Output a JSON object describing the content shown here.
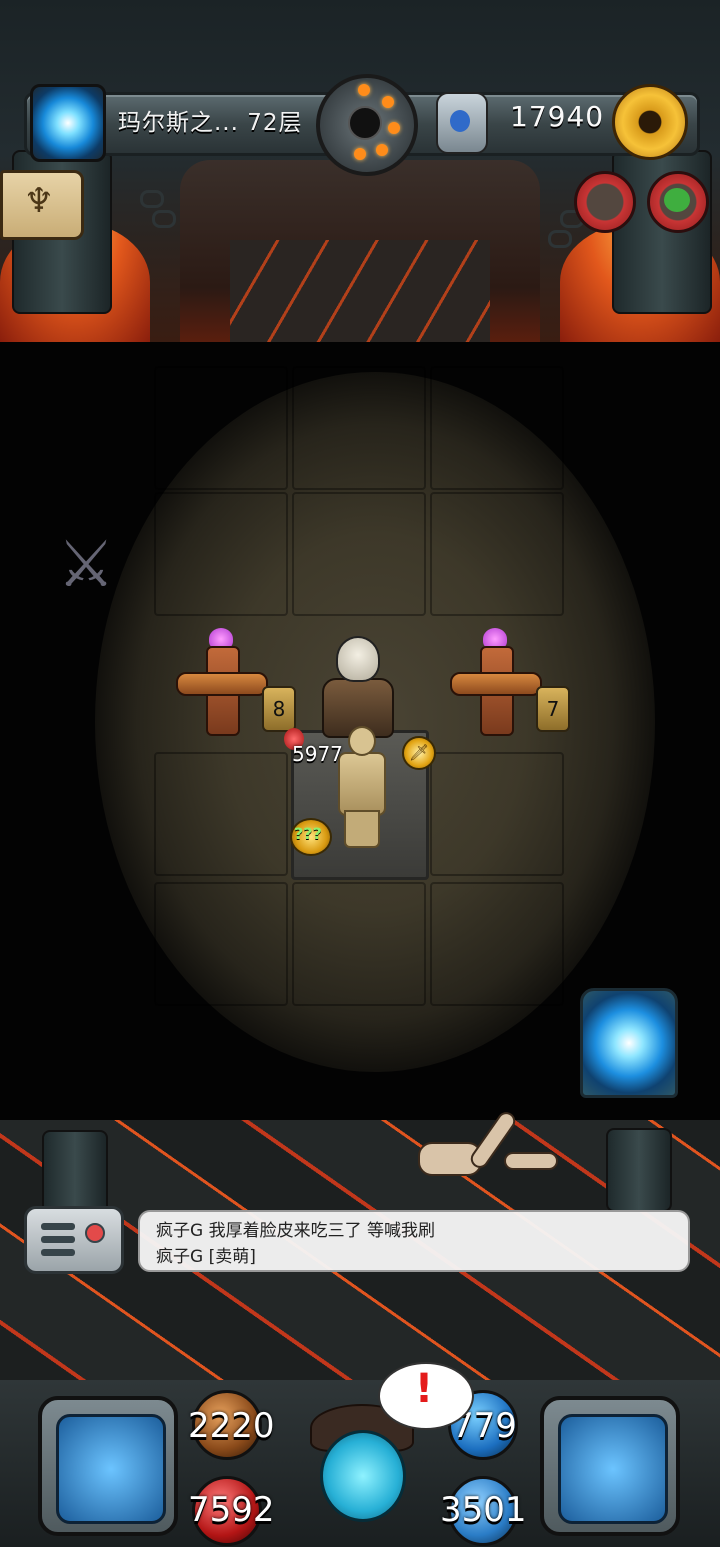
{
  "header": {
    "level_name": "玛尔斯之... 72层",
    "gold": "17940",
    "icons": {
      "portal": "portal-icon",
      "bomb_dial": "bomb-dial-icon",
      "rune": "rune-stone-icon",
      "settings": "gear-icon",
      "scroll": "candelabra-scroll-icon",
      "event1": "treasure-event-icon",
      "event2": "green-monster-event-icon"
    }
  },
  "dungeon": {
    "totem_left_counter": "8",
    "totem_right_counter": "7",
    "enemy_hp": "5977",
    "mystery_label": "???",
    "icons": {
      "sword_badge": "sword-badge-icon",
      "crossed_swords": "crossed-swords-icon",
      "floor_portal": "floor-portal-icon"
    }
  },
  "chat": {
    "lines": [
      "疯子G  我厚着脸皮来吃三了 等喊我刷",
      "疯子G  [卖萌]"
    ]
  },
  "hud": {
    "attack": "2220",
    "mana": "779",
    "hp": "7592",
    "defense": "3501",
    "alert": "!"
  },
  "colors": {
    "lava": "#e2581c",
    "gold": "#f6c238",
    "portal_blue": "#1d8fe0",
    "alert_red": "#e41b1b"
  }
}
